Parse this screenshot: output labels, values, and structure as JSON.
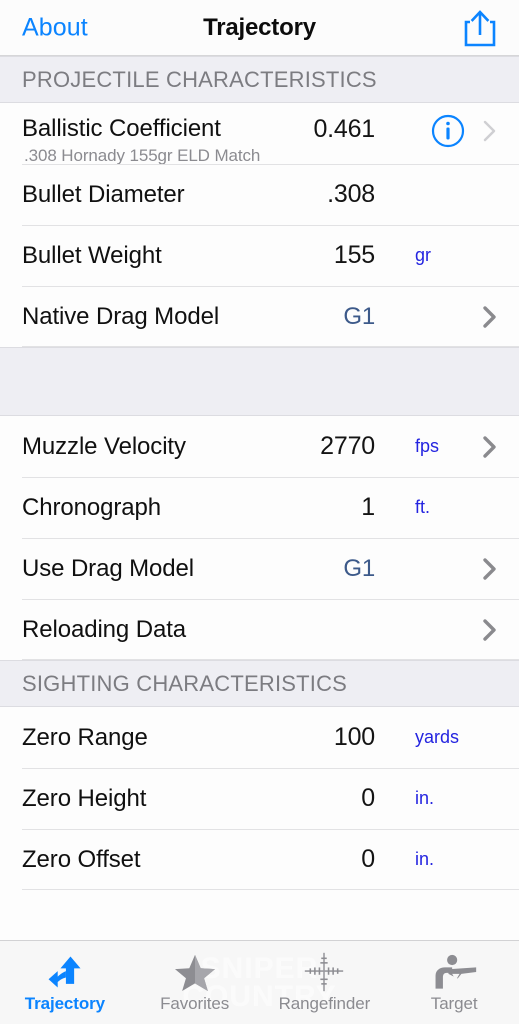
{
  "navbar": {
    "back_label": "About",
    "title": "Trajectory",
    "share_icon": "share-icon"
  },
  "sections": [
    {
      "header": "PROJECTILE CHARACTERISTICS",
      "rows": [
        {
          "label": "Ballistic Coefficient",
          "sublabel": ".308 Hornady 155gr ELD Match",
          "value": "0.461",
          "unit": "",
          "info": true,
          "chevron": "dim"
        },
        {
          "label": "Bullet Diameter",
          "value": ".308",
          "unit": "",
          "chevron": "none"
        },
        {
          "label": "Bullet Weight",
          "value": "155",
          "unit": "gr",
          "chevron": "none"
        },
        {
          "label": "Native Drag Model",
          "value": "G1",
          "accent": true,
          "unit": "",
          "chevron": "solid"
        }
      ]
    },
    {
      "header": "",
      "spacer": true,
      "rows": [
        {
          "label": "Muzzle Velocity",
          "value": "2770",
          "unit": "fps",
          "chevron": "solid"
        },
        {
          "label": "Chronograph",
          "value": "1",
          "unit": "ft.",
          "chevron": "none"
        },
        {
          "label": "Use Drag Model",
          "value": "G1",
          "accent": true,
          "unit": "",
          "chevron": "solid"
        },
        {
          "label": "Reloading Data",
          "value": "",
          "unit": "",
          "chevron": "solid"
        }
      ]
    },
    {
      "header": "SIGHTING CHARACTERISTICS",
      "rows": [
        {
          "label": "Zero Range",
          "value": "100",
          "unit": "yards",
          "chevron": "none"
        },
        {
          "label": "Zero Height",
          "value": "0",
          "unit": "in.",
          "chevron": "none"
        },
        {
          "label": "Zero Offset",
          "value": "0",
          "unit": "in.",
          "chevron": "none"
        }
      ]
    }
  ],
  "tabbar": {
    "watermark_line1": "SNIPER",
    "watermark_line2": "COUNTRY",
    "tabs": [
      {
        "label": "Trajectory",
        "icon": "trajectory-arrow-icon",
        "active": true
      },
      {
        "label": "Favorites",
        "icon": "star-icon",
        "active": false
      },
      {
        "label": "Rangefinder",
        "icon": "crosshair-icon",
        "active": false
      },
      {
        "label": "Target",
        "icon": "shooter-icon",
        "active": false
      }
    ]
  },
  "colors": {
    "accent_blue": "#0b84ff",
    "unit_blue": "#2424e0",
    "drag_model_blue": "#3d5a8a",
    "section_bg": "#eeeef3",
    "chevron_gray": "#8a8a8e"
  }
}
